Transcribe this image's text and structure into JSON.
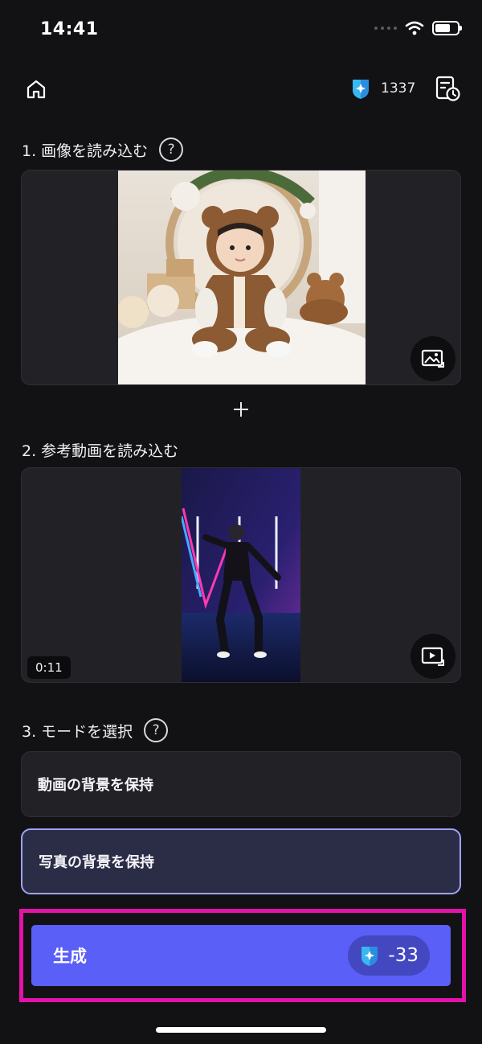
{
  "status_bar": {
    "time": "14:41"
  },
  "header": {
    "credits": "1337",
    "icons": [
      "home-icon",
      "credit-badge-icon",
      "history-icon"
    ]
  },
  "sections": {
    "image": {
      "label": "1. 画像を読み込む",
      "help": "?"
    },
    "video": {
      "label": "2. 参考動画を読み込む",
      "duration": "0:11"
    },
    "mode": {
      "label": "3. モードを選択",
      "help": "?"
    }
  },
  "plus": "+",
  "modes": [
    {
      "label": "動画の背景を保持",
      "selected": false
    },
    {
      "label": "写真の背景を保持",
      "selected": true
    }
  ],
  "generate": {
    "label": "生成",
    "cost": "-33"
  },
  "colors": {
    "accent": "#5a5ff7",
    "highlight": "#e412a8",
    "selected_border": "#9fa3ff",
    "background": "#121215"
  }
}
